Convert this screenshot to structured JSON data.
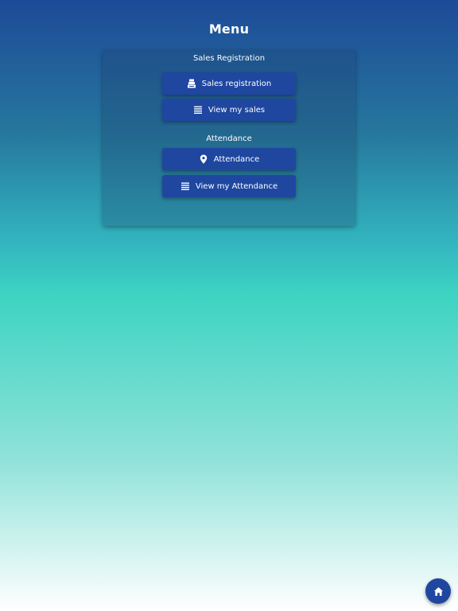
{
  "header": {
    "title": "Menu"
  },
  "sections": [
    {
      "title": "Sales Registration",
      "buttons": [
        {
          "label": "Sales registration",
          "icon": "cash-register-icon"
        },
        {
          "label": "View my sales",
          "icon": "list-icon"
        }
      ]
    },
    {
      "title": "Attendance",
      "buttons": [
        {
          "label": "Attendance",
          "icon": "map-pin-icon"
        },
        {
          "label": "View my Attendance",
          "icon": "list-icon"
        }
      ]
    }
  ],
  "fab": {
    "icon": "home-icon"
  },
  "colors": {
    "button": "#1f47a0",
    "text": "#ffffff"
  }
}
